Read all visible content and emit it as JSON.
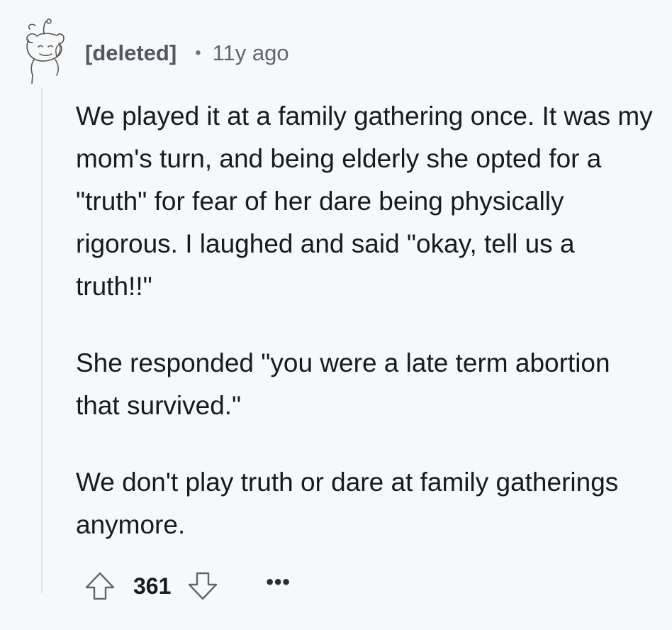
{
  "comment": {
    "author": "[deleted]",
    "separator": "•",
    "age": "11y ago",
    "paragraphs": [
      "We played it at a family gathering once. It was my mom's turn, and being elderly she opted for a \"truth\" for fear of her dare being physically rigorous. I laughed and said \"okay, tell us a truth!!\"",
      "She responded \"you were a late term abortion that survived.\"",
      "We don't play truth or dare at family gatherings anymore."
    ],
    "score": "361",
    "more_label": "•••",
    "icons": {
      "avatar": "deleted-user-snoo-avatar",
      "upvote": "upvote-arrow-icon",
      "downvote": "downvote-arrow-icon",
      "more": "more-options-icon"
    }
  },
  "colors": {
    "background": "#f7f8fa",
    "text": "#181a1f",
    "meta_text": "#505862",
    "thread_line": "#dfe2e8"
  }
}
